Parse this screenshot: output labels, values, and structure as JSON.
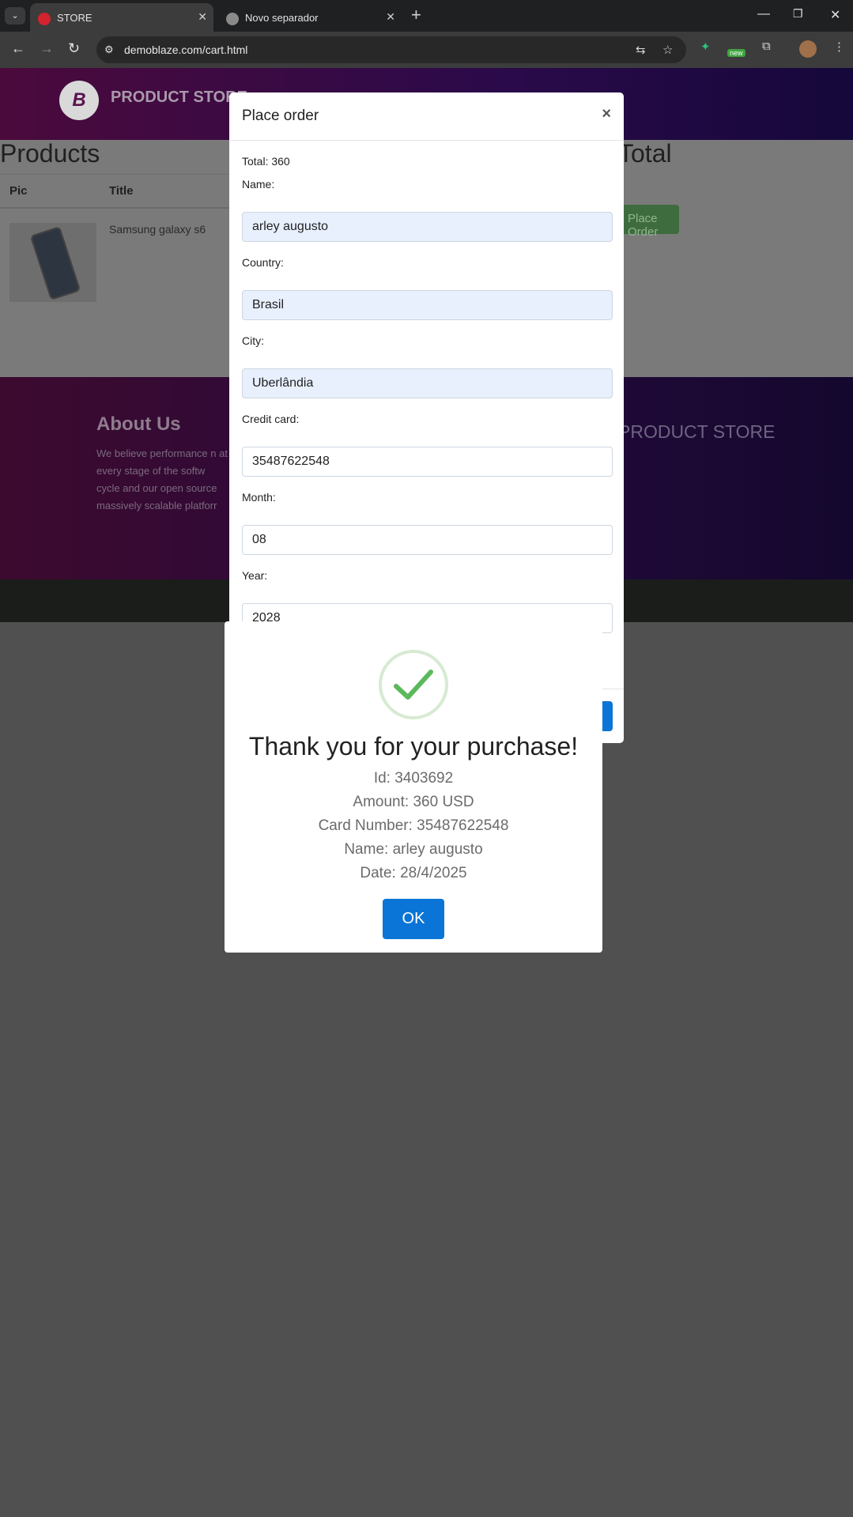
{
  "browser": {
    "tabs": [
      {
        "title": "STORE",
        "active": true
      },
      {
        "title": "Novo separador",
        "active": false
      }
    ],
    "url": "demoblaze.com/cart.html",
    "extension_badge": "new"
  },
  "page": {
    "brand": "PRODUCT STORE",
    "products_heading": "Products",
    "total_heading": "Total",
    "table_headers": [
      "Pic",
      "Title"
    ],
    "row_title": "Samsung galaxy s6",
    "place_order_button": "Place Order",
    "footer_about_heading": "About Us",
    "footer_about_text": "We believe performance n at every stage of the softw cycle and our open source massively scalable platforr reality.",
    "footer_brand": "PRODUCT STORE"
  },
  "order_modal": {
    "title": "Place order",
    "close": "×",
    "total": "Total: 360",
    "name_label": "Name:",
    "name_value": "arley augusto",
    "country_label": "Country:",
    "country_value": "Brasil",
    "city_label": "City:",
    "city_value": "Uberlândia",
    "card_label": "Credit card:",
    "card_value": "35487622548",
    "month_label": "Month:",
    "month_value": "08",
    "year_label": "Year:",
    "year_value": "2028"
  },
  "alert": {
    "title": "Thank you for your purchase!",
    "id": "Id: 3403692",
    "amount": "Amount: 360 USD",
    "card": "Card Number: 35487622548",
    "name": "Name: arley augusto",
    "date": "Date: 28/4/2025",
    "ok": "OK"
  },
  "colors": {
    "primary_button": "#0a75d6",
    "check_green": "#5cb85c",
    "overlay": "#505050"
  }
}
